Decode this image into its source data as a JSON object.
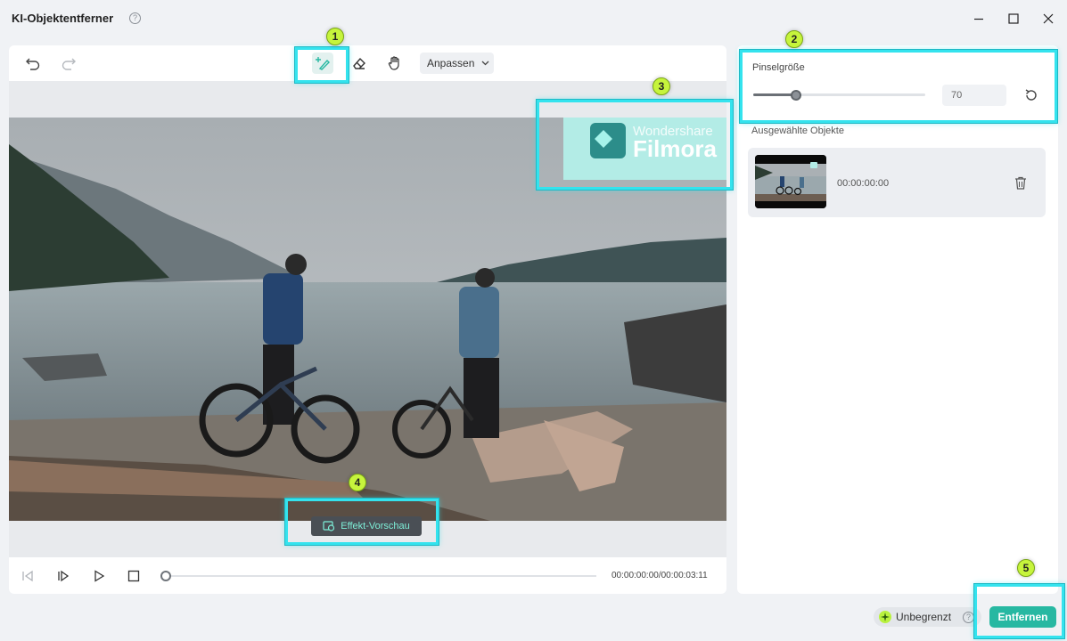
{
  "window": {
    "title": "KI-Objektentferner"
  },
  "toolbar": {
    "fit_label": "Anpassen"
  },
  "preview": {
    "effect_button": "Effekt-Vorschau",
    "watermark_brand": "Wondershare",
    "watermark_product": "Filmora"
  },
  "playback": {
    "timecode": "00:00:00:00/00:00:03:11",
    "progress": 0.0
  },
  "brush": {
    "label": "Pinselgröße",
    "value": "70",
    "slider_fraction": 0.25
  },
  "objects": {
    "label": "Ausgewählte Objekte",
    "items": [
      {
        "time": "00:00:00:00"
      }
    ]
  },
  "footer": {
    "unlimited_label": "Unbegrenzt",
    "remove_label": "Entfernen"
  },
  "annotations": {
    "badges": [
      "1",
      "2",
      "3",
      "4",
      "5"
    ]
  },
  "colors": {
    "accent": "#27b8a2",
    "highlight": "#34e3ee",
    "badge": "#c6f43c"
  }
}
